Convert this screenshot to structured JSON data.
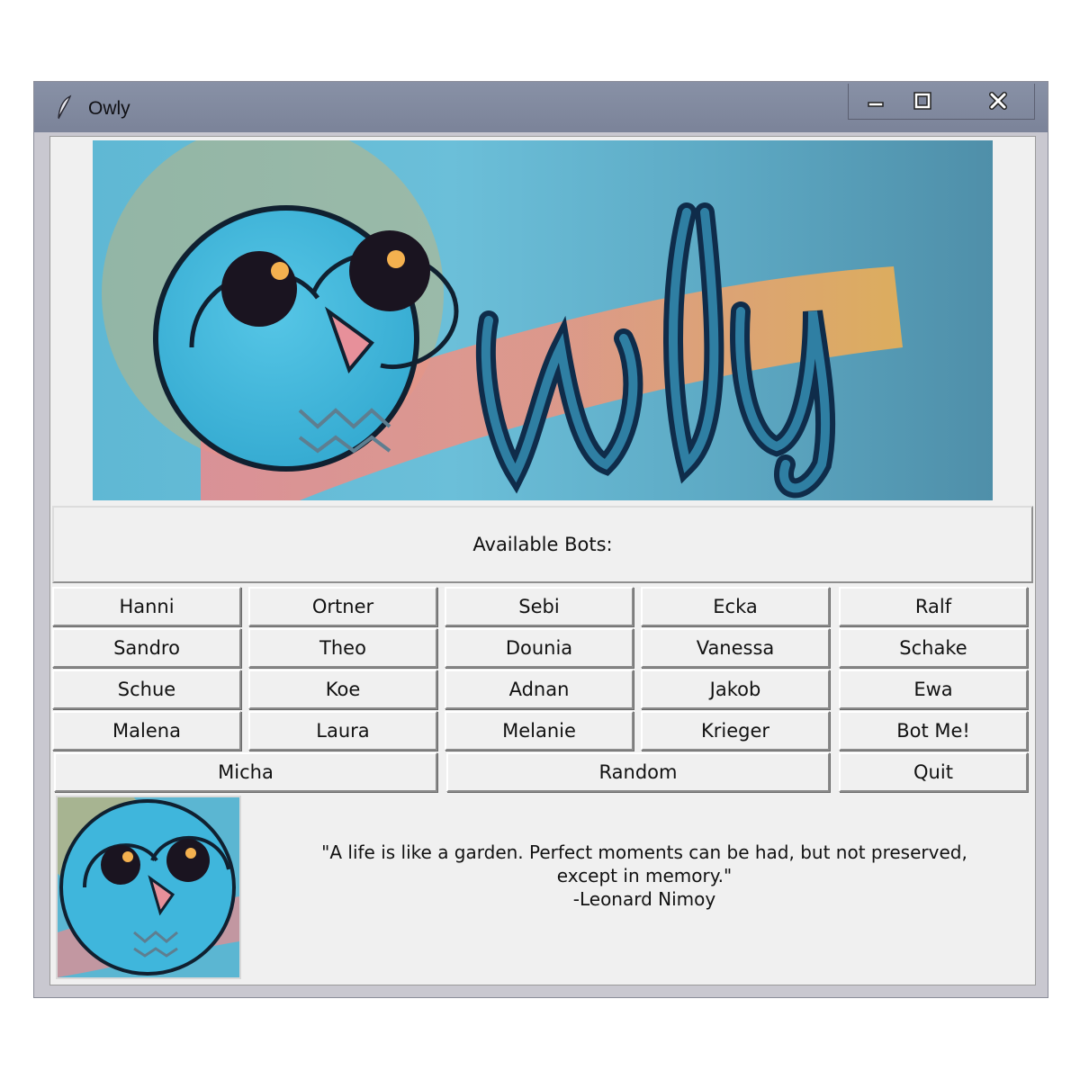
{
  "window": {
    "title": "Owly",
    "icon": "feather-icon",
    "controls": [
      "minimize-icon",
      "maximize-icon",
      "close-icon"
    ]
  },
  "banner": {
    "logo_text": "Owly"
  },
  "header": {
    "label": "Available Bots:"
  },
  "bots": {
    "row1": [
      "Hanni",
      "Ortner",
      "Sebi",
      "Ecka",
      "Ralf"
    ],
    "row2": [
      "Sandro",
      "Theo",
      "Dounia",
      "Vanessa",
      "Schake"
    ],
    "row3": [
      "Schue",
      "Koe",
      "Adnan",
      "Jakob",
      "Ewa"
    ],
    "row4": [
      "Malena",
      "Laura",
      "Melanie",
      "Krieger",
      "Bot Me!"
    ]
  },
  "actions": {
    "micha": "Micha",
    "random": "Random",
    "quit": "Quit"
  },
  "quote": {
    "line1": "\"A life is like a garden. Perfect moments can be had, but not preserved,",
    "line2": "except in memory.\"",
    "author": "-Leonard Nimoy"
  },
  "colors": {
    "sky": "#5fb8d4",
    "owl": "#3fb6dc",
    "accent_orange": "#f4b14f",
    "accent_pink": "#ee8a8c"
  }
}
